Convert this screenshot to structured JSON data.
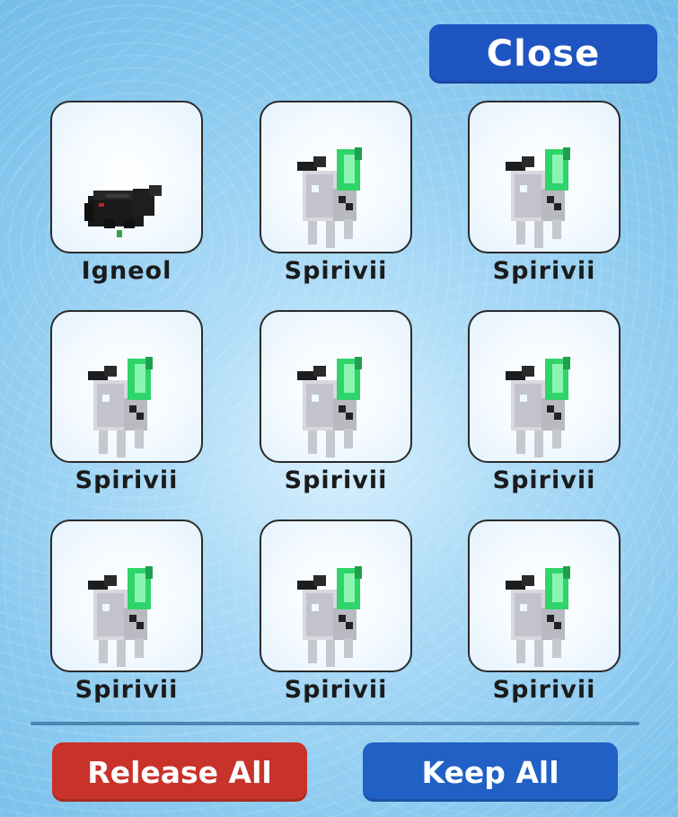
{
  "header": {
    "close_label": "Close"
  },
  "pets": [
    {
      "name": "Igneol",
      "sprite": "igneol-sprite"
    },
    {
      "name": "Spirivii",
      "sprite": "spirivii-sprite"
    },
    {
      "name": "Spirivii",
      "sprite": "spirivii-sprite"
    },
    {
      "name": "Spirivii",
      "sprite": "spirivii-sprite"
    },
    {
      "name": "Spirivii",
      "sprite": "spirivii-sprite"
    },
    {
      "name": "Spirivii",
      "sprite": "spirivii-sprite"
    },
    {
      "name": "Spirivii",
      "sprite": "spirivii-sprite"
    },
    {
      "name": "Spirivii",
      "sprite": "spirivii-sprite"
    },
    {
      "name": "Spirivii",
      "sprite": "spirivii-sprite"
    }
  ],
  "footer": {
    "release_label": "Release All",
    "keep_label": "Keep All"
  },
  "colors": {
    "close_button": "#1f55c1",
    "release_button": "#c8322a",
    "keep_button": "#2160c4",
    "crystal": "#2fd46a"
  }
}
